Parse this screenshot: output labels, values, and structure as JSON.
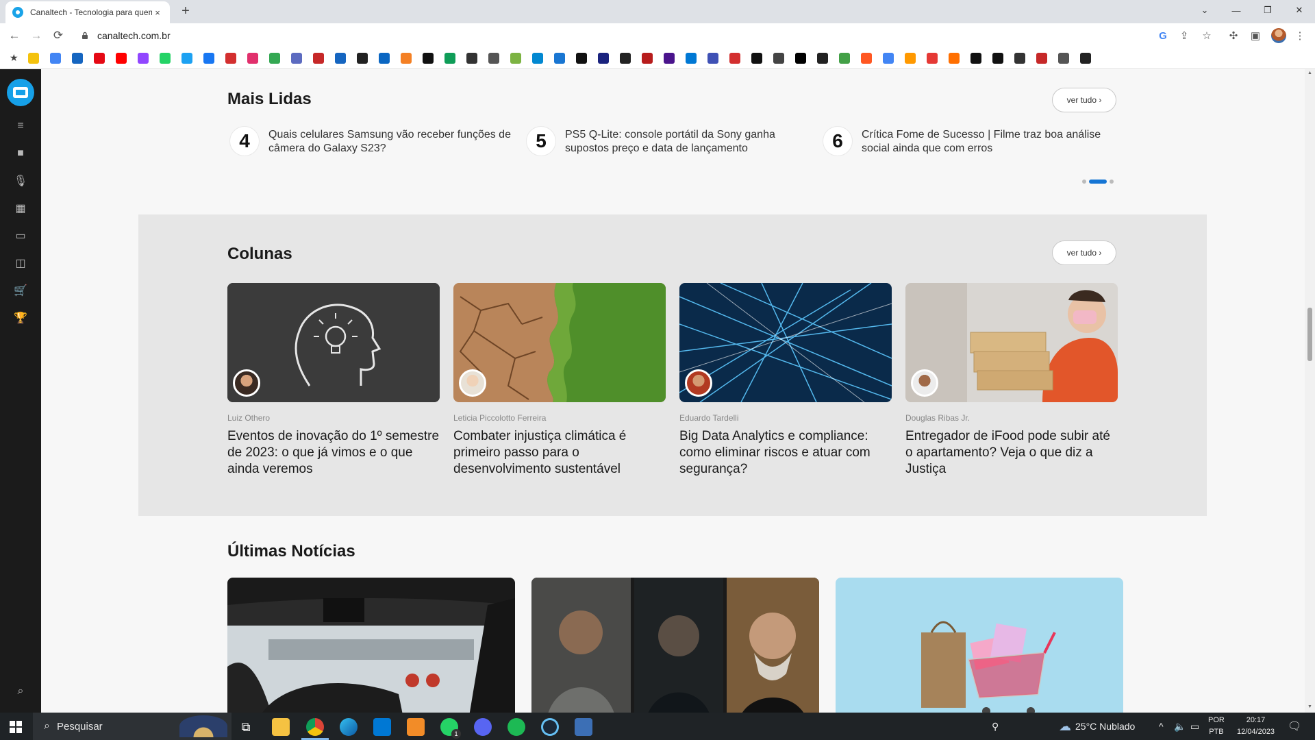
{
  "browser": {
    "tab_title": "Canaltech - Tecnologia para quem...",
    "tab_close": "×",
    "new_tab": "+",
    "url": "canaltech.com.br"
  },
  "bookmark_colors": [
    "#f4c20d",
    "#4285f4",
    "#1565c0",
    "#e50914",
    "#ff0000",
    "#9146ff",
    "#25d366",
    "#1da1f2",
    "#1877f2",
    "#d32f2f",
    "#e1306c",
    "#34a853",
    "#5c6bc0",
    "#c62828",
    "#1565c0",
    "#222",
    "#0a66c2",
    "#f48024",
    "#111",
    "#0f9d58",
    "#333",
    "#555",
    "#7cb342",
    "#0288d1",
    "#1976d2",
    "#111",
    "#1a237e",
    "#222",
    "#b71c1c",
    "#4a148c",
    "#0078d4",
    "#3f51b5",
    "#d32f2f",
    "#111",
    "#444",
    "#000",
    "#222",
    "#43a047",
    "#ff5722",
    "#4285f4",
    "#ff9900",
    "#e53935",
    "#ff6f00",
    "#111",
    "#111",
    "#333",
    "#c62828",
    "#555",
    "#222"
  ],
  "site": {
    "mais_lidas": {
      "title": "Mais Lidas",
      "ver_tudo": "ver tudo ›",
      "items": [
        {
          "num": "4",
          "text": "Quais celulares Samsung vão receber funções de câmera do Galaxy S23?"
        },
        {
          "num": "5",
          "text": "PS5 Q-Lite: console portátil da Sony ganha supostos preço e data de lançamento"
        },
        {
          "num": "6",
          "text": "Crítica Fome de Sucesso | Filme traz boa análise social ainda que com erros"
        }
      ]
    },
    "colunas": {
      "title": "Colunas",
      "ver_tudo": "ver tudo ›",
      "cards": [
        {
          "author": "Luiz Othero",
          "headline": "Eventos de inovação do 1º semestre de 2023: o que já vimos e o que ainda veremos"
        },
        {
          "author": "Leticia Piccolotto Ferreira",
          "headline": "Combater injustiça climática é primeiro passo para o desenvolvimento sustentável"
        },
        {
          "author": "Eduardo Tardelli",
          "headline": "Big Data Analytics e compliance: como eliminar riscos e atuar com segurança?"
        },
        {
          "author": "Douglas Ribas Jr.",
          "headline": "Entregador de iFood pode subir até o apartamento? Veja o que diz a Justiça"
        }
      ]
    },
    "ultimas": {
      "title": "Últimas Notícias"
    }
  },
  "taskbar": {
    "search_placeholder": "Pesquisar",
    "weather": "25°C  Nublado",
    "lang_top": "POR",
    "lang_bottom": "PTB",
    "time": "20:17",
    "date": "12/04/2023",
    "whatsapp_badge": "1"
  },
  "colors": {
    "accent": "#1575d4",
    "brand": "#16a0e8",
    "sidebar": "#1b1b1b"
  }
}
